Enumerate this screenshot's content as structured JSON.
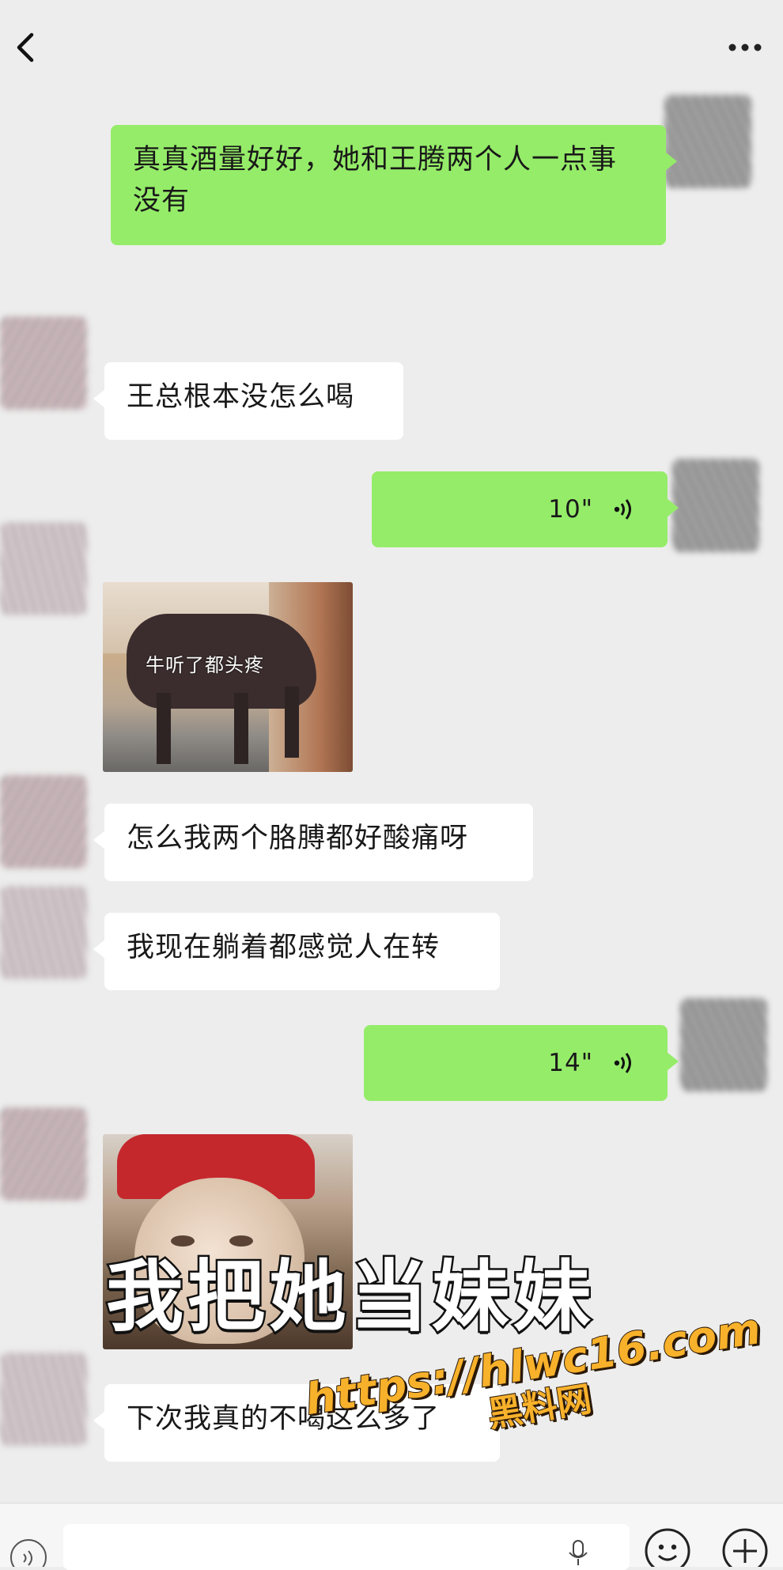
{
  "header": {
    "back_icon": "chevron-left-icon",
    "more_icon": "more-horizontal-icon"
  },
  "messages": [
    {
      "direction": "outgoing",
      "type": "text",
      "text": "真真酒量好好，她和王腾两个人一点事没有"
    },
    {
      "direction": "incoming",
      "type": "text",
      "text": "王总根本没怎么喝"
    },
    {
      "direction": "outgoing",
      "type": "voice",
      "duration": "10\"",
      "icon": "voice-wave-icon"
    },
    {
      "direction": "incoming",
      "type": "image",
      "caption": "牛听了都头疼"
    },
    {
      "direction": "incoming",
      "type": "text",
      "text": "怎么我两个胳膊都好酸痛呀"
    },
    {
      "direction": "incoming",
      "type": "text",
      "text": "我现在躺着都感觉人在转"
    },
    {
      "direction": "outgoing",
      "type": "voice",
      "duration": "14\"",
      "icon": "voice-wave-icon"
    },
    {
      "direction": "incoming",
      "type": "image",
      "caption": ""
    },
    {
      "direction": "incoming",
      "type": "text",
      "text": "下次我真的不喝这么多了"
    }
  ],
  "overlay": {
    "caption": "我把她当妹妹",
    "watermark_url": "https://hlwc16.com",
    "watermark_name": "黑料网"
  },
  "bottom_bar": {
    "icons": [
      "voice-toggle-icon",
      "mic-icon",
      "emoji-icon",
      "plus-icon"
    ]
  }
}
